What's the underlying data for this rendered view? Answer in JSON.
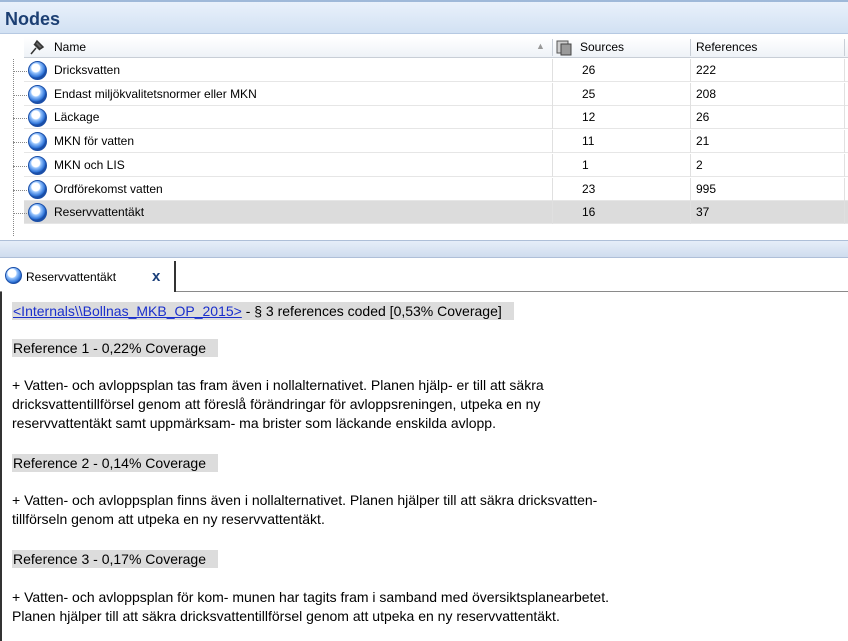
{
  "nodes_panel": {
    "title": "Nodes",
    "columns": {
      "name": "Name",
      "sources": "Sources",
      "references": "References"
    },
    "rows": [
      {
        "name": "Dricksvatten",
        "sources": "26",
        "references": "222",
        "selected": false
      },
      {
        "name": "Endast miljökvalitetsnormer eller MKN",
        "sources": "25",
        "references": "208",
        "selected": false
      },
      {
        "name": "Läckage",
        "sources": "12",
        "references": "26",
        "selected": false
      },
      {
        "name": "MKN för vatten",
        "sources": "11",
        "references": "21",
        "selected": false
      },
      {
        "name": "MKN och LIS",
        "sources": "1",
        "references": "2",
        "selected": false
      },
      {
        "name": "Ordförekomst vatten",
        "sources": "23",
        "references": "995",
        "selected": false
      },
      {
        "name": "Reservvattentäkt",
        "sources": "16",
        "references": "37",
        "selected": true
      }
    ]
  },
  "detail": {
    "tab_label": "Reservvattentäkt",
    "close_label": "x",
    "source_link": "<Internals\\\\Bollnas_MKB_OP_2015>",
    "source_summary": " - § 3 references coded  [0,53% Coverage]",
    "references": [
      {
        "heading": "Reference 1 - 0,22% Coverage",
        "lines": [
          "+ Vatten- och avloppsplan tas fram även i nollalternativet. Planen hjälp- er till att säkra",
          "dricksvattentillförsel genom att föreslå förändringar för avloppsreningen, utpeka en ny",
          "reservvattentäkt samt uppmärksam- ma brister som läckande enskilda avlopp."
        ]
      },
      {
        "heading": "Reference 2 - 0,14% Coverage",
        "lines": [
          "+ Vatten- och avloppsplan finns även i nollalternativet. Planen hjälper till att säkra dricksvatten-",
          "tillförseln genom att utpeka en ny reservvattentäkt."
        ]
      },
      {
        "heading": "Reference 3 - 0,17% Coverage",
        "lines": [
          "+ Vatten- och avloppsplan för kom- munen har tagits fram i samband med översiktsplanearbetet.",
          "Planen hjälper till att säkra dricksvattentillförsel genom att utpeka en ny reservvattentäkt."
        ]
      }
    ]
  },
  "colors": {
    "header_title": "#1c3f73",
    "link": "#1a2fcc",
    "highlight": "#dcdcdc",
    "node_icon": "#2f74d8"
  }
}
